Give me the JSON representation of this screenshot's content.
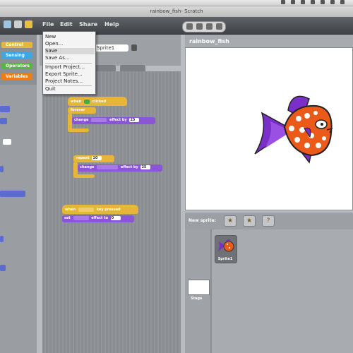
{
  "window": {
    "title": "rainbow_fish- Scratch"
  },
  "menubar": {
    "file": "File",
    "edit": "Edit",
    "share": "Share",
    "help": "Help"
  },
  "file_menu": {
    "items": [
      "New",
      "Open...",
      "Save",
      "Save As...",
      "Import Project...",
      "Export Sprite...",
      "Project Notes...",
      "Quit"
    ]
  },
  "categories": {
    "control": "Control",
    "sensing": "Sensing",
    "operators": "Operators",
    "variables": "Variables"
  },
  "sprite": {
    "name": "Sprite1"
  },
  "scripts": {
    "stack1": {
      "hat": "when",
      "hat2": "clicked",
      "loop": "forever",
      "action": "change",
      "action_mid": "effect by",
      "value": "25"
    },
    "stack2": {
      "loop": "repeat",
      "count": "10",
      "action": "change",
      "action_mid": "effect by",
      "value": "25"
    },
    "stack3": {
      "hat": "when",
      "hat_mid": "key pressed",
      "action": "set",
      "action_mid": "effect to",
      "value": "0"
    }
  },
  "stage": {
    "title": "rainbow_fish"
  },
  "sprites_pane": {
    "new_sprite_label": "New sprite:",
    "stage_label": "Stage",
    "sprite1_label": "Sprite1"
  },
  "colors": {
    "control": "#e5b637",
    "looks": "#8a55d7",
    "motion": "#4a6cd4",
    "fish_body": "#ec5a1a",
    "fish_fins": "#7b2fc9"
  }
}
